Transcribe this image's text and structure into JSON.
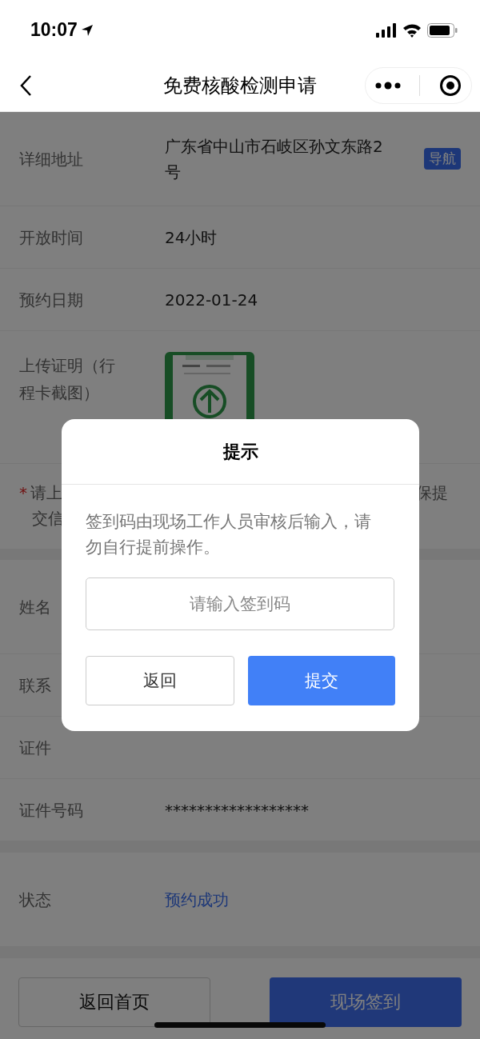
{
  "status_bar": {
    "time": "10:07"
  },
  "nav": {
    "title": "免费核酸检测申请"
  },
  "details": [
    {
      "kind": "text",
      "label": "详细地址",
      "value": "广东省中山市石岐区孙文东路2号",
      "action": "导航"
    },
    {
      "kind": "text",
      "label": "开放时间",
      "value": "24小时"
    },
    {
      "kind": "text",
      "label": "预约日期",
      "value": "2022-01-24"
    },
    {
      "label": "上传证明（行程卡截图）"
    }
  ],
  "notice": {
    "mark": "*",
    "line_1_start": "请上",
    "line_1_end": "保提",
    "line_2_start": "交信"
  },
  "person": [
    {
      "label": "姓名"
    },
    {
      "label": "联系"
    },
    {
      "label": "证件"
    },
    {
      "label": "证件号码",
      "value": "******************"
    }
  ],
  "status": {
    "label": "状态",
    "value": "预约成功"
  },
  "buttons": [
    {
      "label": "返回首页",
      "kind": "secondary"
    },
    {
      "label": "现场签到",
      "kind": "primary"
    }
  ],
  "dialog": {
    "title": "提示",
    "message": "签到码由现场工作人员审核后输入，请勿自行提前操作。",
    "input": {
      "placeholder": "请输入签到码"
    },
    "buttons": [
      {
        "label": "返回",
        "kind": "secondary"
      },
      {
        "label": "提交",
        "kind": "primary"
      }
    ]
  }
}
